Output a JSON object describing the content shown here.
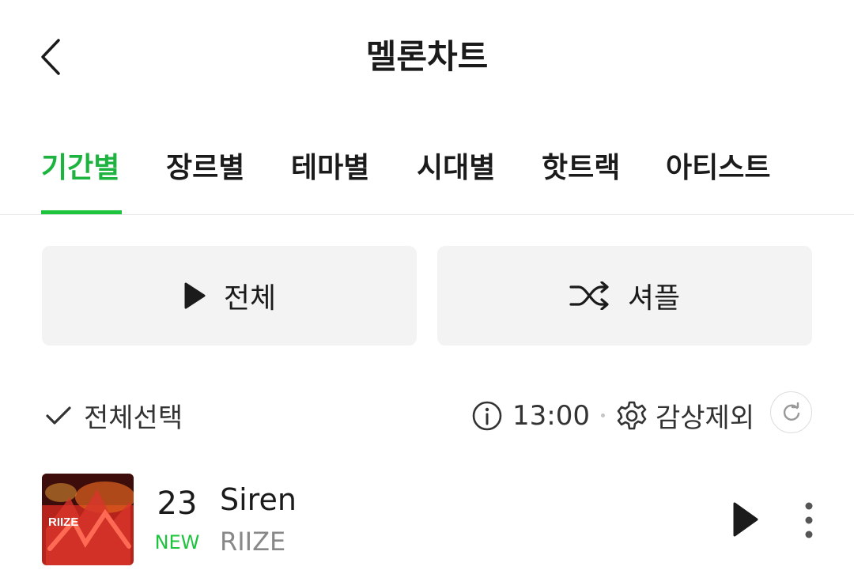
{
  "header": {
    "title": "멜론차트",
    "back_icon": "chevron-left-icon"
  },
  "tabs": [
    {
      "label": "기간별",
      "active": true
    },
    {
      "label": "장르별",
      "active": false
    },
    {
      "label": "테마별",
      "active": false
    },
    {
      "label": "시대별",
      "active": false
    },
    {
      "label": "핫트랙",
      "active": false
    },
    {
      "label": "아티스트",
      "active": false
    }
  ],
  "actions": {
    "play_all_label": "전체",
    "play_all_icon": "play-icon",
    "shuffle_label": "셔플",
    "shuffle_icon": "shuffle-icon"
  },
  "controls": {
    "select_all_label": "전체선택",
    "select_all_icon": "checkmark-icon",
    "update_time": "13:00",
    "info_icon": "info-icon",
    "exclude_label": "감상제외",
    "exclude_icon": "gear-icon",
    "refresh_icon": "refresh-icon"
  },
  "songs": [
    {
      "rank": "23",
      "rank_change": "NEW",
      "title": "Siren",
      "artist": "RIIZE",
      "album_art_text": "RIIZE"
    }
  ],
  "colors": {
    "accent_green": "#1ec43d",
    "active_tab_text": "#1db33f",
    "button_bg": "#f3f3f3",
    "divider": "#e6e6e6",
    "artist_gray": "#888888"
  }
}
